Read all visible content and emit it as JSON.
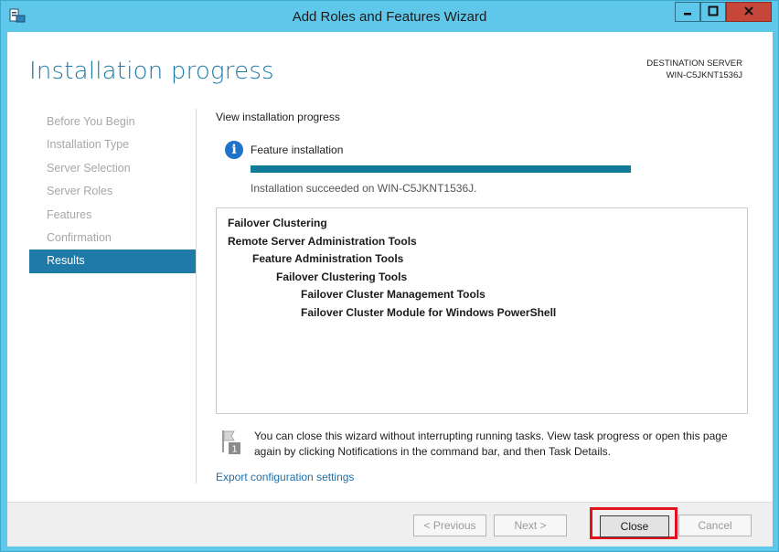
{
  "window": {
    "title": "Add Roles and Features Wizard",
    "app_icon": "server-manager-icon",
    "controls": {
      "minimize": "minimize-icon",
      "maximize": "maximize-icon",
      "close": "close-icon"
    }
  },
  "header": {
    "page_title": "Installation progress",
    "destination_label": "DESTINATION SERVER",
    "destination_server": "WIN-C5JKNT1536J"
  },
  "nav": {
    "items": [
      {
        "label": "Before You Begin",
        "active": false
      },
      {
        "label": "Installation Type",
        "active": false
      },
      {
        "label": "Server Selection",
        "active": false
      },
      {
        "label": "Server Roles",
        "active": false
      },
      {
        "label": "Features",
        "active": false
      },
      {
        "label": "Confirmation",
        "active": false
      },
      {
        "label": "Results",
        "active": true
      }
    ]
  },
  "content": {
    "section_label": "View installation progress",
    "feature_title": "Feature installation",
    "progress_fraction": 1.0,
    "status": "Installation succeeded on WIN-C5JKNT1536J.",
    "results": [
      {
        "text": "Failover Clustering",
        "level": 0
      },
      {
        "text": "Remote Server Administration Tools",
        "level": 0
      },
      {
        "text": "Feature Administration Tools",
        "level": 1
      },
      {
        "text": "Failover Clustering Tools",
        "level": 2
      },
      {
        "text": "Failover Cluster Management Tools",
        "level": 3
      },
      {
        "text": "Failover Cluster Module for Windows PowerShell",
        "level": 3
      }
    ],
    "note": "You can close this wizard without interrupting running tasks. View task progress or open this page again by clicking Notifications in the command bar, and then Task Details.",
    "export_link": "Export configuration settings"
  },
  "footer": {
    "previous": "< Previous",
    "next": "Next >",
    "close": "Close",
    "cancel": "Cancel"
  },
  "colors": {
    "title_bar": "#5fc8ea",
    "accent": "#1f7aa8",
    "progress": "#0f7b98",
    "highlight": "#e3111b"
  }
}
